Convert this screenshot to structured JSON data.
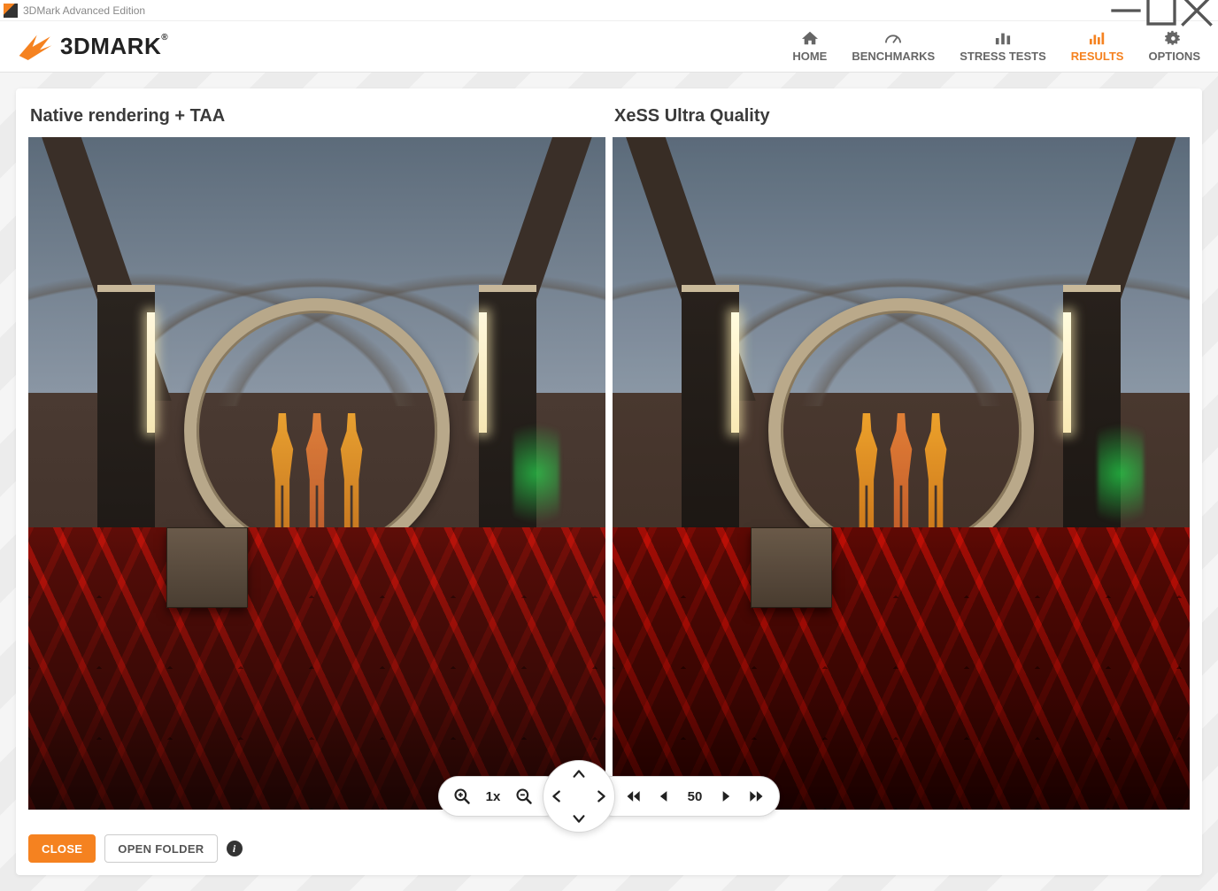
{
  "window": {
    "title": "3DMark Advanced Edition"
  },
  "logo": {
    "text": "3DMARK"
  },
  "nav": {
    "home": "HOME",
    "benchmarks": "BENCHMARKS",
    "stress": "STRESS TESTS",
    "results": "RESULTS",
    "options": "OPTIONS",
    "active": "results"
  },
  "compare": {
    "left_label": "Native rendering + TAA",
    "right_label": "XeSS Ultra Quality"
  },
  "controls": {
    "zoom_level": "1x",
    "frame_index": "50"
  },
  "buttons": {
    "close": "CLOSE",
    "open_folder": "OPEN FOLDER"
  },
  "colors": {
    "accent": "#f58220"
  }
}
